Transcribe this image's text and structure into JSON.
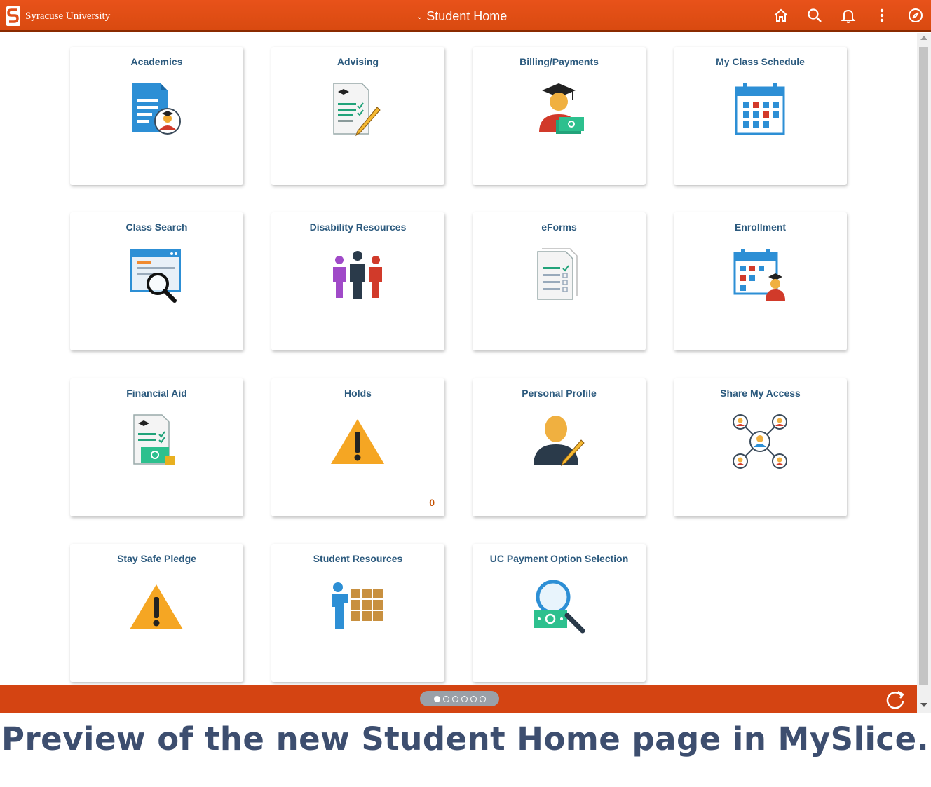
{
  "header": {
    "university_name": "Syracuse University",
    "page_title": "Student Home",
    "colors": {
      "bar": "#e0501a",
      "footer": "#d44412"
    }
  },
  "top_icons": [
    "home-icon",
    "search-icon",
    "bell-icon",
    "more-vertical-icon",
    "compass-icon"
  ],
  "tiles": [
    {
      "title": "Academics",
      "icon": "document-student-icon"
    },
    {
      "title": "Advising",
      "icon": "document-pencil-icon"
    },
    {
      "title": "Billing/Payments",
      "icon": "graduate-money-icon"
    },
    {
      "title": "My Class Schedule",
      "icon": "calendar-icon"
    },
    {
      "title": "Class Search",
      "icon": "window-magnifier-icon"
    },
    {
      "title": "Disability Resources",
      "icon": "people-group-icon"
    },
    {
      "title": "eForms",
      "icon": "forms-checklist-icon"
    },
    {
      "title": "Enrollment",
      "icon": "calendar-student-icon"
    },
    {
      "title": "Financial Aid",
      "icon": "document-money-icon"
    },
    {
      "title": "Holds",
      "icon": "warning-icon",
      "count": "0"
    },
    {
      "title": "Personal Profile",
      "icon": "person-pencil-icon"
    },
    {
      "title": "Share My Access",
      "icon": "network-people-icon"
    },
    {
      "title": "Stay Safe Pledge",
      "icon": "warning-icon"
    },
    {
      "title": "Student Resources",
      "icon": "person-blocks-icon"
    },
    {
      "title": "UC Payment Option Selection",
      "icon": "magnifier-money-icon"
    }
  ],
  "pager": {
    "pages": 6,
    "active_page": 1
  },
  "caption": "Preview of the new Student Home page in MySlice."
}
